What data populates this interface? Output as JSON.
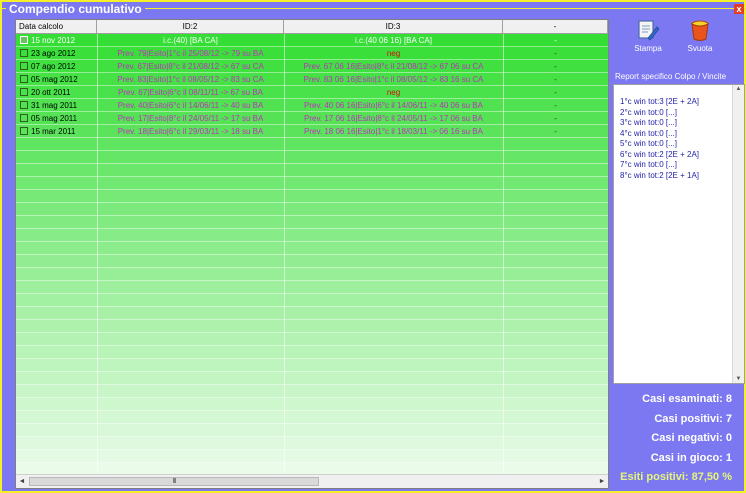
{
  "window": {
    "title": "Compendio cumulativo",
    "close": "x"
  },
  "table": {
    "columns": [
      "Data calcolo",
      "ID:2",
      "ID:3",
      "-"
    ],
    "rows": [
      {
        "date": "15 nov 2012",
        "id2": "i.c.(40) [BA CA]",
        "id3": "i.c.(40 06 16) [BA CA]",
        "x": "-"
      },
      {
        "date": "23 ago 2012",
        "id2": "Prev. 79|Esito|1°c il 25/08/12 -> 79 su BA",
        "id3": "neg",
        "x": "-"
      },
      {
        "date": "07 ago 2012",
        "id2": "Prev. 67|Esito|8°c il 21/08/12 -> 67 su CA",
        "id3": "Prev. 67 06 16|Esito|8°c il 21/08/12 -> 67 06 su CA",
        "x": "-"
      },
      {
        "date": "05 mag 2012",
        "id2": "Prev. 83|Esito|1°c il 08/05/12 -> 83 su CA",
        "id3": "Prev. 83 06 16|Esito|1°c il 08/05/12 -> 83 16 su CA",
        "x": "-"
      },
      {
        "date": "20 ott 2011",
        "id2": "Prev. 67|Esito|6°c il 08/11/11 -> 67 su BA",
        "id3": "neg",
        "x": "-"
      },
      {
        "date": "31 mag 2011",
        "id2": "Prev. 40|Esito|6°c il 14/06/11 -> 40 su BA",
        "id3": "Prev. 40 06 16|Esito|6°c il 14/06/11 -> 40 06 su BA",
        "x": "-"
      },
      {
        "date": "05 mag 2011",
        "id2": "Prev. 17|Esito|8°c il 24/05/11 -> 17 su BA",
        "id3": "Prev. 17 06 16|Esito|8°c il 24/05/11 -> 17 06 su BA",
        "x": "-"
      },
      {
        "date": "15 mar 2011",
        "id2": "Prev. 18|Esito|6°c il 29/03/11 -> 18 su BA",
        "id3": "Prev. 18 06 16|Esito|1°c il 18/03/11 -> 06 16 su BA",
        "x": "-"
      }
    ],
    "scroll_left": "◄",
    "scroll_right": "►",
    "thumb_grip": "III"
  },
  "toolbar": {
    "print_label": "Stampa",
    "clear_label": "Svuota"
  },
  "report": {
    "label": "Report specifico Colpo / Vincite",
    "items": [
      "1°c win tot:3 [2E + 2A]",
      "2°c win tot:0 [...]",
      "3°c win tot:0 [...]",
      "4°c win tot:0 [...]",
      "5°c win tot:0 [...]",
      "6°c win tot:2 [2E + 2A]",
      "7°c win tot:0 [...]",
      "8°c win tot:2 [2E + 1A]"
    ],
    "scroll_up": "▲",
    "scroll_down": "▼"
  },
  "stats": {
    "examined": "Casi esaminati: 8",
    "positive": "Casi positivi: 7",
    "negative": "Casi negativi: 0",
    "in_play": "Casi in gioco: 1",
    "positive_rate": "Esiti positivi: 87,50 %"
  },
  "colors": {
    "frame": "#7b78f2",
    "border": "#f5ef2a",
    "row_green_top": "#33dd33",
    "row_green_bottom": "#eafbea",
    "selected": "#3c98f4",
    "esito_text": "#c030c0",
    "neg_text": "#d01010"
  }
}
